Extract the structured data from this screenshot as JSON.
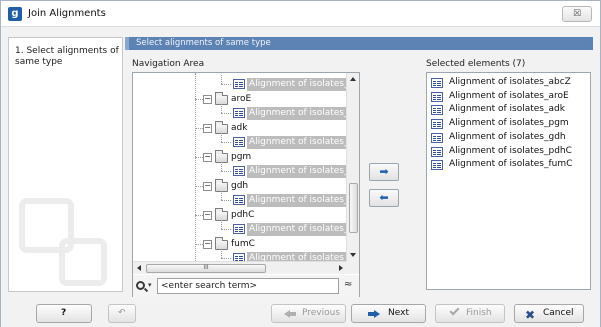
{
  "window": {
    "title": "Join Alignments",
    "app_icon_letter": "g",
    "close_glyph": "☒"
  },
  "steps": [
    {
      "label": "1.  Select alignments of same type"
    }
  ],
  "panel": {
    "header": "Select alignments of same type",
    "nav_area_label": "Navigation Area",
    "selected_label": "Selected elements (7)"
  },
  "tree": {
    "rows": [
      {
        "kind": "alignment",
        "label": "Alignment of isolates_abcZ",
        "selected_grey": true
      },
      {
        "kind": "folder",
        "label": "aroE"
      },
      {
        "kind": "alignment",
        "label": "Alignment of isolates_aroE",
        "selected_grey": true
      },
      {
        "kind": "folder",
        "label": "adk"
      },
      {
        "kind": "alignment",
        "label": "Alignment of isolates_adk",
        "selected_grey": true
      },
      {
        "kind": "folder",
        "label": "pgm"
      },
      {
        "kind": "alignment",
        "label": "Alignment of isolates_pgm",
        "selected_grey": true
      },
      {
        "kind": "folder",
        "label": "gdh"
      },
      {
        "kind": "alignment",
        "label": "Alignment of isolates_gdh",
        "selected_grey": true
      },
      {
        "kind": "folder",
        "label": "pdhC"
      },
      {
        "kind": "alignment",
        "label": "Alignment of isolates_pdhC",
        "selected_grey": true
      },
      {
        "kind": "folder",
        "label": "fumC"
      },
      {
        "kind": "alignment",
        "label": "Alignment of isolates_fumC",
        "selected_grey": true
      }
    ],
    "hscroll_thumb_glyph": "III"
  },
  "search": {
    "placeholder": "<enter search term>",
    "dropdown_glyph": "▾",
    "sort_glyph": "≈"
  },
  "move_buttons": {
    "add_glyph": "➡",
    "remove_glyph": "⬅"
  },
  "selected_elements": [
    "Alignment of isolates_abcZ",
    "Alignment of isolates_aroE",
    "Alignment of isolates_adk",
    "Alignment of isolates_pgm",
    "Alignment of isolates_gdh",
    "Alignment of isolates_pdhC",
    "Alignment of isolates_fumC"
  ],
  "footer": {
    "help_label": "?",
    "reset_glyph": "↶",
    "previous_label": "Previous",
    "next_label": "Next",
    "finish_label": "Finish",
    "cancel_label": "Cancel",
    "cancel_glyph": "✖"
  },
  "colors": {
    "header_bg": "#5d83b5",
    "grey_selection": "#bcbcbc",
    "accent_blue": "#1f5fa8"
  }
}
